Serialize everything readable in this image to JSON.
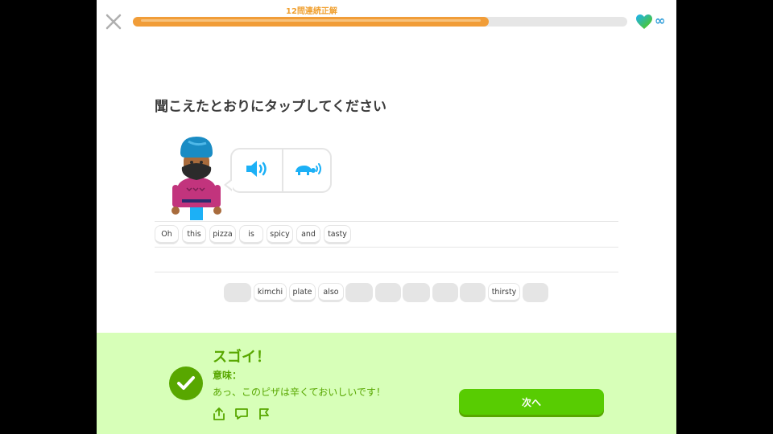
{
  "header": {
    "streak_text": "12問連続正解",
    "progress_fraction": 0.72,
    "hearts_value": "∞"
  },
  "prompt": {
    "instruction": "聞こえたとおりにタップしてください"
  },
  "audio": {
    "normal_icon": "speaker-icon",
    "slow_icon": "turtle-speaker-icon"
  },
  "answer": {
    "words": [
      "Oh",
      "this",
      "pizza",
      "is",
      "spicy",
      "and",
      "tasty"
    ]
  },
  "word_bank": {
    "items": [
      {
        "label": "",
        "used": true
      },
      {
        "label": "kimchi",
        "used": false
      },
      {
        "label": "plate",
        "used": false
      },
      {
        "label": "also",
        "used": false
      },
      {
        "label": "",
        "used": true
      },
      {
        "label": "",
        "used": true
      },
      {
        "label": "",
        "used": true
      },
      {
        "label": "",
        "used": true
      },
      {
        "label": "",
        "used": true
      },
      {
        "label": "thirsty",
        "used": false
      },
      {
        "label": "",
        "used": true
      }
    ]
  },
  "feedback": {
    "title": "スゴイ！",
    "meaning_label": "意味：",
    "meaning_text": "あっ、このピザは辛くておいしいです！",
    "next_label": "次へ",
    "icons": [
      "share-icon",
      "comment-icon",
      "flag-icon"
    ]
  },
  "colors": {
    "accent_green": "#58cc02",
    "feedback_bg": "#d7ffb8",
    "progress_orange": "#f19d38",
    "audio_blue": "#1cb0f6"
  }
}
